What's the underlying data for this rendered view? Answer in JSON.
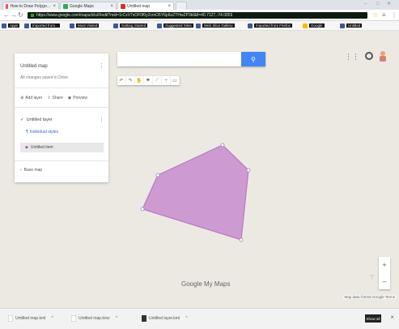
{
  "tabs": [
    {
      "label": "How to Draw Polygons on Google Maps",
      "favicon_color": "#ef5350"
    },
    {
      "label": "Google Maps",
      "favicon_color": "#34a853"
    },
    {
      "label": "Untitled map",
      "favicon_color": "#d93025"
    }
  ],
  "window_controls": [
    "–",
    "□",
    "✕"
  ],
  "address": {
    "url": "https://www.google.com/maps/d/u/0/edit?mid=1rCzV7xOF0f0y2cmO5Y6p6oZTHwZP3kI&ll=40.7127,-74.0059"
  },
  "bookmarks": [
    "Bookmarks bar",
    "Apps",
    "Imported from...",
    "Most Visited",
    "Getting Started",
    "Suggested Sites",
    "Web Slice Gallery",
    "Imported from Firefox",
    "Google",
    "Untitled"
  ],
  "panel": {
    "title": "Untitled map",
    "subtitle": "All changes saved in Drive",
    "actions": [
      "Add layer",
      "Share",
      "Preview"
    ],
    "layer_title": "Untitled layer",
    "layer_link": "Individual styles",
    "item": "Untitled item",
    "basemap": "Base map"
  },
  "search": {
    "placeholder": ""
  },
  "tools": [
    "undo-icon",
    "redo-icon",
    "hand-icon",
    "marker-icon",
    "line-icon",
    "route-icon",
    "ruler-icon"
  ],
  "map": {
    "attribution": "Map data ©2015 Google   Terms",
    "logo": "Google My Maps",
    "polygon_fill": "#c98ccf",
    "polygon_stroke": "#b67bc1"
  },
  "downloads": [
    {
      "name": "Untitled map.kml"
    },
    {
      "name": "Untitled map.kmz"
    },
    {
      "name": "Untitled layer.kml"
    }
  ],
  "downloads_show_all": "Show all"
}
